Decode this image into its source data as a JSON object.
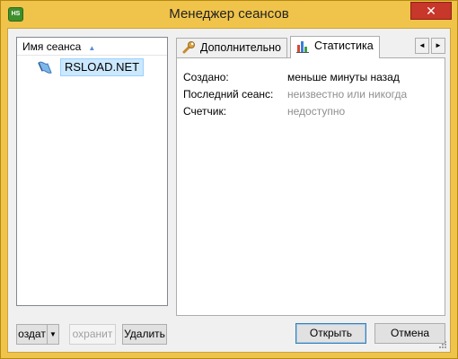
{
  "window": {
    "title": "Менеджер сеансов",
    "app_icon_text": "HS",
    "close_glyph": "✕"
  },
  "tree": {
    "header": "Имя сеанса",
    "items": [
      {
        "label": "RSLOAD.NET"
      }
    ]
  },
  "tabs": [
    {
      "label": "Дополнительно",
      "icon": "wrench-icon"
    },
    {
      "label": "Статистика",
      "icon": "bar-chart-icon"
    }
  ],
  "tab_scroll": {
    "left": "◄",
    "right": "►"
  },
  "stats": {
    "created_label": "Создано:",
    "created_value": "меньше минуты назад",
    "last_session_label": "Последний сеанс:",
    "last_session_value": "неизвестно или никогда",
    "counter_label": "Счетчик:",
    "counter_value": "недоступно"
  },
  "buttons": {
    "create": "оздат",
    "create_arrow": "▼",
    "save": "охранит",
    "delete": "Удалить",
    "open": "Открыть",
    "cancel": "Отмена"
  },
  "colors": {
    "title_bar": "#f0c34a",
    "selection": "#cce8ff",
    "close_button": "#c7372a"
  }
}
